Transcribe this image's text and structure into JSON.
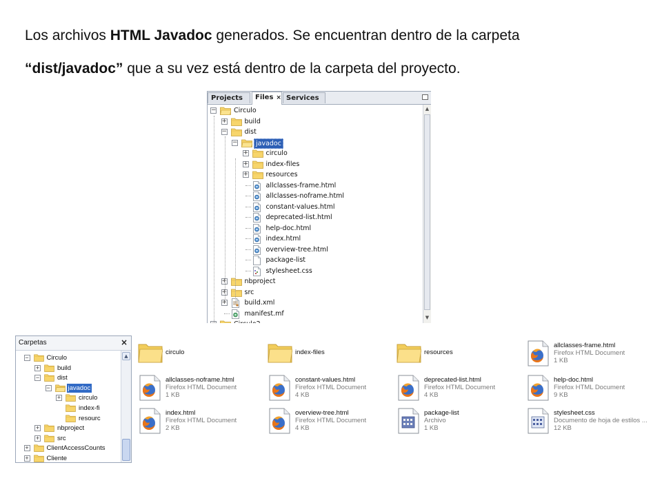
{
  "caption": {
    "line1_pre": "Los archivos ",
    "line1_bold": "HTML Javadoc",
    "line1_post": " generados. Se encuentran dentro de la carpeta",
    "line2_open_quote": "“",
    "line2_bold": "dist/javadoc”",
    "line2_post": " que a su vez está dentro de la carpeta del proyecto."
  },
  "netbeans": {
    "tabs": {
      "projects": "Projects",
      "files": "Files",
      "files_close": "×",
      "services": "Services"
    },
    "tree": [
      {
        "label": "Circulo",
        "depth": 0,
        "icon": "project-folder-icon",
        "expander": "−"
      },
      {
        "label": "build",
        "depth": 1,
        "icon": "folder-icon",
        "expander": "+"
      },
      {
        "label": "dist",
        "depth": 1,
        "icon": "folder-icon",
        "expander": "−"
      },
      {
        "label": "javadoc",
        "depth": 2,
        "icon": "folder-open-icon",
        "expander": "−",
        "selected": true
      },
      {
        "label": "circulo",
        "depth": 3,
        "icon": "folder-icon",
        "expander": "+"
      },
      {
        "label": "index-files",
        "depth": 3,
        "icon": "folder-icon",
        "expander": "+"
      },
      {
        "label": "resources",
        "depth": 3,
        "icon": "folder-icon",
        "expander": "+"
      },
      {
        "label": "allclasses-frame.html",
        "depth": 3,
        "icon": "html-file-icon",
        "expander": ""
      },
      {
        "label": "allclasses-noframe.html",
        "depth": 3,
        "icon": "html-file-icon",
        "expander": ""
      },
      {
        "label": "constant-values.html",
        "depth": 3,
        "icon": "html-file-icon",
        "expander": ""
      },
      {
        "label": "deprecated-list.html",
        "depth": 3,
        "icon": "html-file-icon",
        "expander": ""
      },
      {
        "label": "help-doc.html",
        "depth": 3,
        "icon": "html-file-icon",
        "expander": ""
      },
      {
        "label": "index.html",
        "depth": 3,
        "icon": "html-file-icon",
        "expander": ""
      },
      {
        "label": "overview-tree.html",
        "depth": 3,
        "icon": "html-file-icon",
        "expander": ""
      },
      {
        "label": "package-list",
        "depth": 3,
        "icon": "text-file-icon",
        "expander": ""
      },
      {
        "label": "stylesheet.css",
        "depth": 3,
        "icon": "css-file-icon",
        "expander": ""
      },
      {
        "label": "nbproject",
        "depth": 1,
        "icon": "folder-icon",
        "expander": "+"
      },
      {
        "label": "src",
        "depth": 1,
        "icon": "folder-icon",
        "expander": "+"
      },
      {
        "label": "build.xml",
        "depth": 1,
        "icon": "ant-file-icon",
        "expander": "+"
      },
      {
        "label": "manifest.mf",
        "depth": 1,
        "icon": "manifest-file-icon",
        "expander": ""
      },
      {
        "label": "Circulo2",
        "depth": 0,
        "icon": "project-folder-icon",
        "expander": "−"
      }
    ]
  },
  "explorer": {
    "title": "Carpetas",
    "close": "×",
    "tree": [
      {
        "label": "Circulo",
        "depth": 1,
        "expander": "−"
      },
      {
        "label": "build",
        "depth": 2,
        "expander": "+"
      },
      {
        "label": "dist",
        "depth": 2,
        "expander": "−"
      },
      {
        "label": "javadoc",
        "depth": 3,
        "expander": "−",
        "selected": true
      },
      {
        "label": "circulo",
        "depth": 4,
        "expander": "+"
      },
      {
        "label": "index-fi",
        "depth": 4,
        "expander": ""
      },
      {
        "label": "resourc",
        "depth": 4,
        "expander": ""
      },
      {
        "label": "nbproject",
        "depth": 2,
        "expander": "+"
      },
      {
        "label": "src",
        "depth": 2,
        "expander": "+"
      },
      {
        "label": "ClientAccessCounts",
        "depth": 1,
        "expander": "+"
      },
      {
        "label": "Cliente",
        "depth": 1,
        "expander": "+"
      }
    ]
  },
  "files": [
    {
      "name": "circulo",
      "kind": "folder"
    },
    {
      "name": "index-files",
      "kind": "folder"
    },
    {
      "name": "resources",
      "kind": "folder"
    },
    {
      "name": "allclasses-frame.html",
      "type": "Firefox HTML Document",
      "size": "1 KB",
      "kind": "firefox"
    },
    {
      "name": "allclasses-noframe.html",
      "type": "Firefox HTML Document",
      "size": "1 KB",
      "kind": "firefox"
    },
    {
      "name": "constant-values.html",
      "type": "Firefox HTML Document",
      "size": "4 KB",
      "kind": "firefox"
    },
    {
      "name": "deprecated-list.html",
      "type": "Firefox HTML Document",
      "size": "4 KB",
      "kind": "firefox"
    },
    {
      "name": "help-doc.html",
      "type": "Firefox HTML Document",
      "size": "9 KB",
      "kind": "firefox"
    },
    {
      "name": "index.html",
      "type": "Firefox HTML Document",
      "size": "2 KB",
      "kind": "firefox"
    },
    {
      "name": "overview-tree.html",
      "type": "Firefox HTML Document",
      "size": "4 KB",
      "kind": "firefox"
    },
    {
      "name": "package-list",
      "type": "Archivo",
      "size": "1 KB",
      "kind": "archive"
    },
    {
      "name": "stylesheet.css",
      "type": "Documento de hoja de estilos ...",
      "size": "12 KB",
      "kind": "css"
    }
  ]
}
